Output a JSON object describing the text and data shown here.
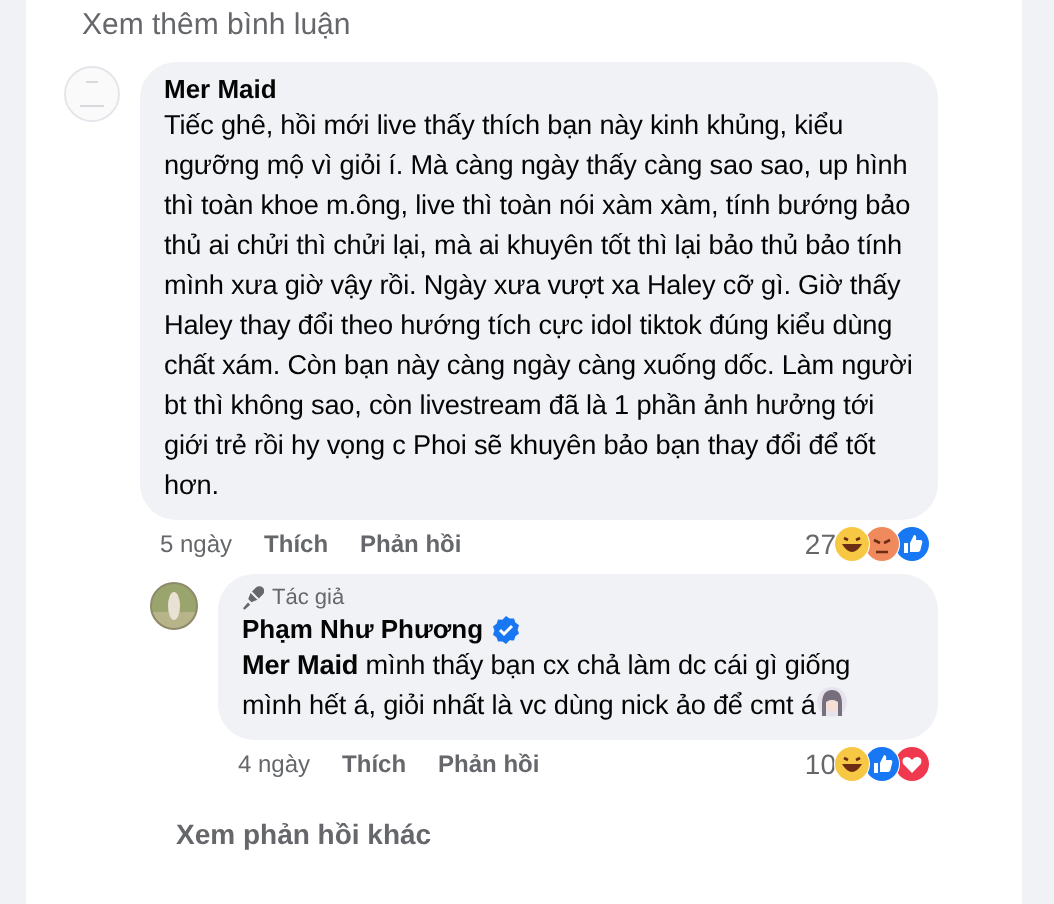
{
  "more_comments_link": "Xem thêm bình luận",
  "comments": [
    {
      "author": "Mer Maid",
      "text": "Tiếc ghê, hồi mới live thấy thích bạn này kinh khủng, kiểu ngưỡng mộ vì giỏi í. Mà càng ngày thấy càng sao sao, up hình thì toàn khoe m.ông, live thì toàn nói xàm xàm, tính bướng bảo thủ ai chửi thì chửi lại, mà ai khuyên tốt thì lại bảo thủ bảo tính mình xưa giờ vậy rồi. Ngày xưa vượt xa Haley cỡ gì. Giờ thấy Haley thay đổi theo hướng tích cực idol tiktok đúng kiểu dùng chất xám. Còn bạn này càng ngày càng xuống dốc. Làm người bt thì không sao, còn livestream đã là 1 phần ảnh hưởng tới giới trẻ rồi hy vọng c Phoi sẽ khuyên bảo bạn thay đổi để tốt hơn.",
      "time": "5 ngày",
      "like": "Thích",
      "reply": "Phản hồi",
      "reaction_count": "27",
      "reactions": [
        {
          "kind": "haha"
        },
        {
          "kind": "angry"
        },
        {
          "kind": "like"
        }
      ],
      "replies": [
        {
          "author": "Phạm Như Phương",
          "author_badge": "Tác giả",
          "verified": true,
          "text": "**Mer Maid** mình thấy bạn cx chả làm dc cái gì giống mình hết á, giỏi nhất là vc dùng nick ảo để cmt á",
          "trailing_emoji": true,
          "time": "4 ngày",
          "like": "Thích",
          "reply": "Phản hồi",
          "reaction_count": "10",
          "reactions": [
            {
              "kind": "haha"
            },
            {
              "kind": "like"
            },
            {
              "kind": "love"
            }
          ]
        }
      ]
    }
  ],
  "more_replies_link": "Xem phản hồi khác"
}
